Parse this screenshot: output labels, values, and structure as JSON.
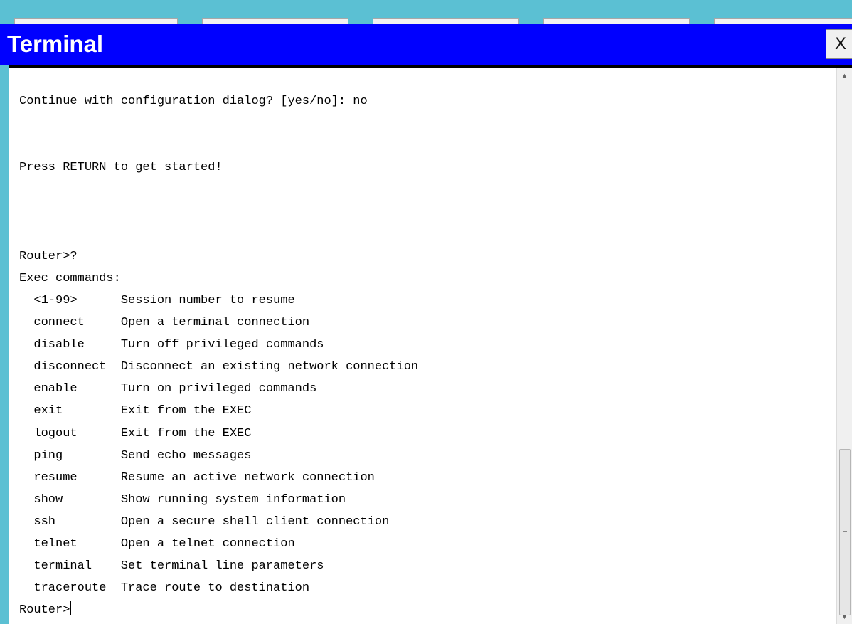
{
  "window": {
    "title": "Terminal",
    "close_label": "X"
  },
  "terminal": {
    "lines": [
      "",
      "Continue with configuration dialog? [yes/no]: no",
      "",
      "",
      "Press RETURN to get started!",
      "",
      "",
      "",
      "Router>?",
      "Exec commands:",
      "  <1-99>      Session number to resume",
      "  connect     Open a terminal connection",
      "  disable     Turn off privileged commands",
      "  disconnect  Disconnect an existing network connection",
      "  enable      Turn on privileged commands",
      "  exit        Exit from the EXEC",
      "  logout      Exit from the EXEC",
      "  ping        Send echo messages",
      "  resume      Resume an active network connection",
      "  show        Show running system information",
      "  ssh         Open a secure shell client connection",
      "  telnet      Open a telnet connection",
      "  terminal    Set terminal line parameters",
      "  traceroute  Trace route to destination"
    ],
    "prompt": "Router>"
  },
  "scrollbar": {
    "up_arrow": "▲",
    "down_arrow": "▼"
  }
}
